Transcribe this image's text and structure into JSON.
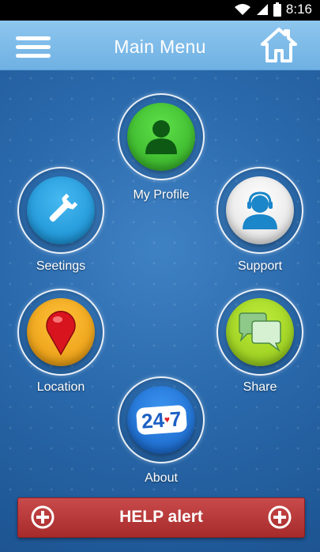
{
  "status_bar": {
    "time": "8:16",
    "icons": [
      "wifi-icon",
      "signal-icon",
      "battery-icon"
    ]
  },
  "header": {
    "title": "Main Menu",
    "menu_icon": "hamburger-icon",
    "home_icon": "home-icon",
    "background": "#7ebbe8"
  },
  "menu": {
    "profile": {
      "label": "My Profile",
      "icon": "person-icon",
      "color": "#3fbf2f"
    },
    "settings": {
      "label": "Seetings",
      "icon": "wrench-icon",
      "color": "#1e9fe0"
    },
    "support": {
      "label": "Support",
      "icon": "headset-agent-icon",
      "color": "#ffffff"
    },
    "location": {
      "label": "Location",
      "icon": "map-pin-icon",
      "color": "#f1a81a"
    },
    "share": {
      "label": "Share",
      "icon": "chat-bubbles-icon",
      "color": "#a6d92a"
    },
    "about": {
      "label": "About",
      "icon": "24-7-icon",
      "badge_text": "24",
      "badge_text_2": "7",
      "color": "#1f73d6"
    }
  },
  "help": {
    "label": "HELP alert",
    "color": "#b83636",
    "icon": "plus-circle-icon"
  }
}
